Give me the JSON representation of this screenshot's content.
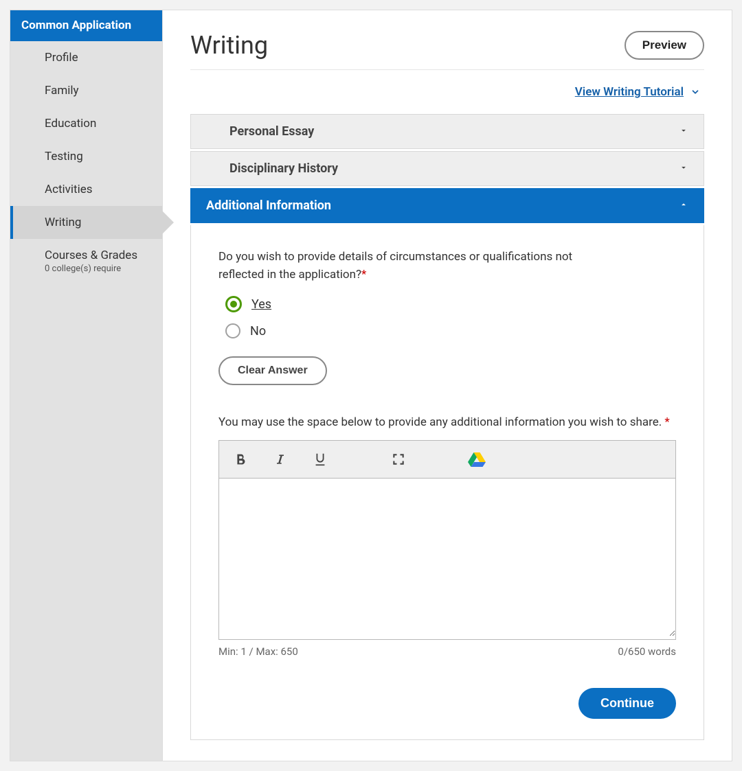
{
  "sidebar": {
    "title": "Common Application",
    "items": [
      {
        "label": "Profile",
        "active": false
      },
      {
        "label": "Family",
        "active": false
      },
      {
        "label": "Education",
        "active": false
      },
      {
        "label": "Testing",
        "active": false
      },
      {
        "label": "Activities",
        "active": false
      },
      {
        "label": "Writing",
        "active": true
      },
      {
        "label": "Courses & Grades",
        "sub": "0 college(s) require",
        "active": false
      }
    ]
  },
  "header": {
    "title": "Writing",
    "preview_label": "Preview",
    "tutorial_link": "View Writing Tutorial"
  },
  "accordions": {
    "personal_essay": "Personal Essay",
    "disciplinary_history": "Disciplinary History",
    "additional_information": "Additional Information"
  },
  "form": {
    "question": "Do you wish to provide details of circumstances or qualifications not reflected in the application?",
    "options": {
      "yes": "Yes",
      "no": "No"
    },
    "selected": "yes",
    "clear_label": "Clear Answer",
    "editor_label": "You may use the space below to provide any additional information you wish to share.",
    "editor_value": "",
    "min_max": "Min: 1 / Max: 650",
    "word_count": "0/650 words",
    "continue_label": "Continue"
  }
}
